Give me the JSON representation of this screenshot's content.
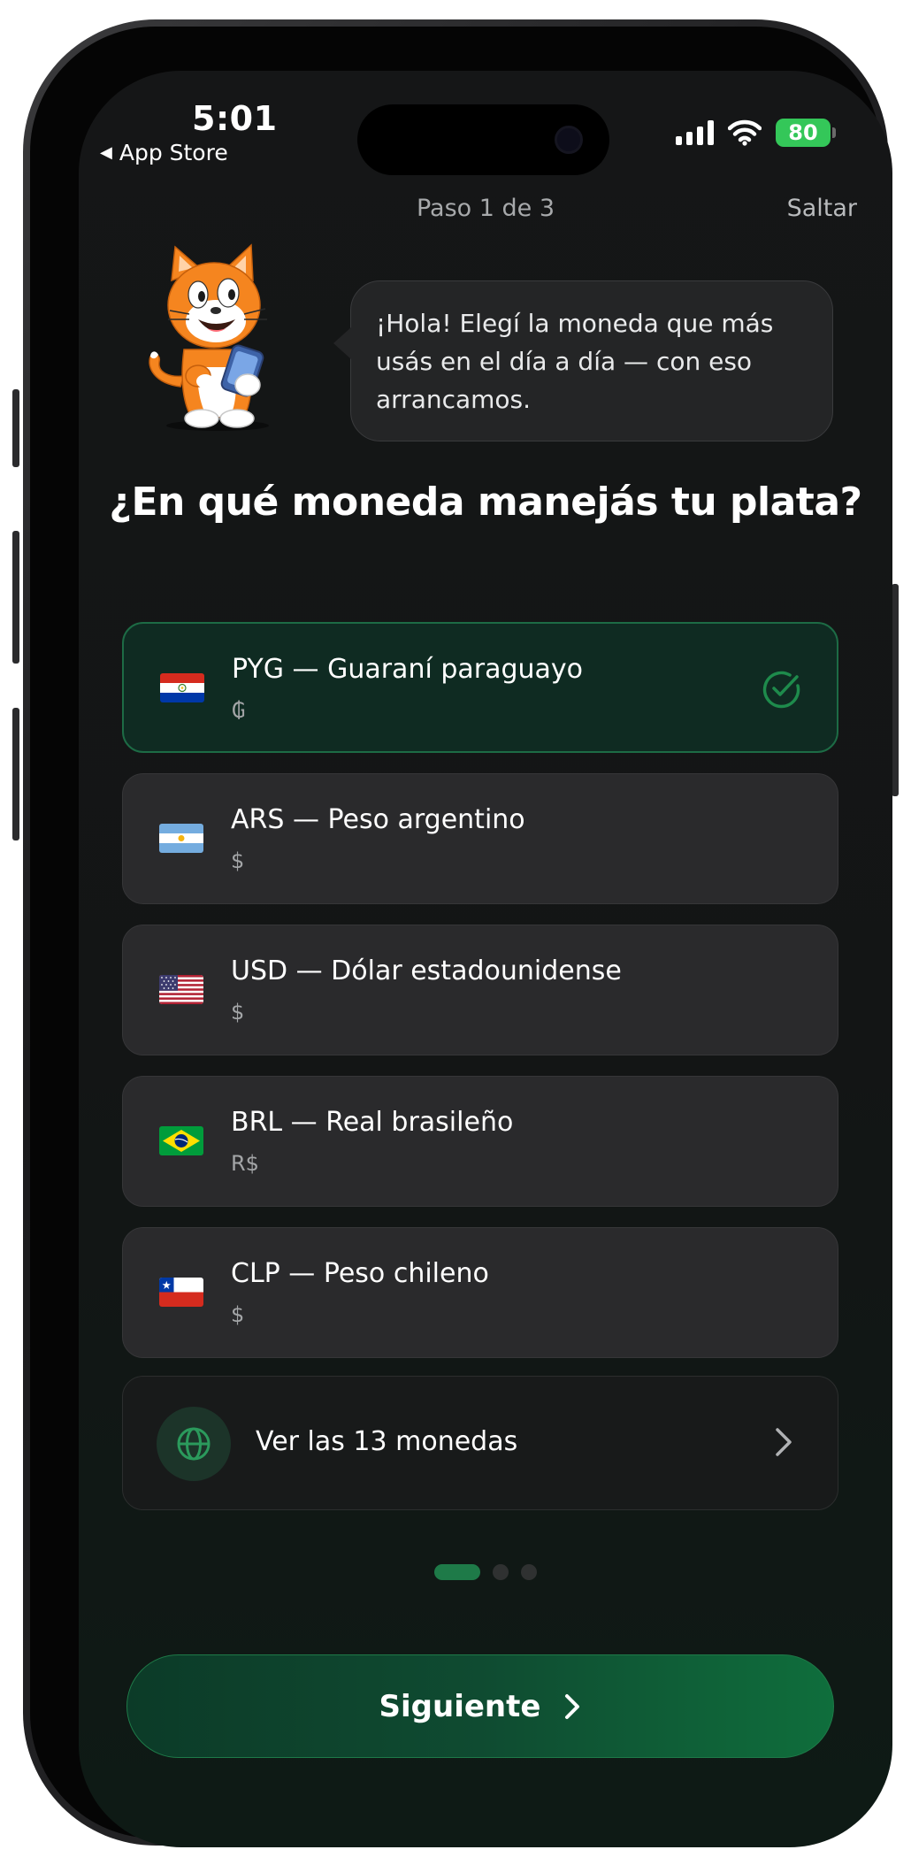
{
  "status_bar": {
    "time": "5:01",
    "back_app": "App Store",
    "battery": "80",
    "icons": [
      "cellular-signal-icon",
      "wifi-icon",
      "battery-icon"
    ]
  },
  "header": {
    "step": "Paso 1 de 3",
    "skip": "Saltar"
  },
  "mascot": {
    "icon": "cat-mascot-with-phone",
    "speech": "¡Hola! Elegí la moneda que más usás en el día a día — con eso arrancamos."
  },
  "question": "¿En qué moneda manejás tu plata?",
  "currencies": [
    {
      "label": "PYG — Guaraní paraguayo",
      "symbol": "₲",
      "flag": "paraguay-flag-icon",
      "selected": true
    },
    {
      "label": "ARS — Peso argentino",
      "symbol": "$",
      "flag": "argentina-flag-icon",
      "selected": false
    },
    {
      "label": "USD — Dólar estadounidense",
      "symbol": "$",
      "flag": "usa-flag-icon",
      "selected": false
    },
    {
      "label": "BRL — Real brasileño",
      "symbol": "R$",
      "flag": "brazil-flag-icon",
      "selected": false
    },
    {
      "label": "CLP — Peso chileno",
      "symbol": "$",
      "flag": "chile-flag-icon",
      "selected": false
    }
  ],
  "view_all": {
    "label": "Ver las 13 monedas",
    "icon": "globe-icon"
  },
  "pager": {
    "current": 1,
    "total": 3
  },
  "next_button": "Siguiente",
  "colors": {
    "accent": "#1e7a48",
    "selected_card": "#0f2b22",
    "card": "#2a2a2c",
    "background": "#151617"
  }
}
